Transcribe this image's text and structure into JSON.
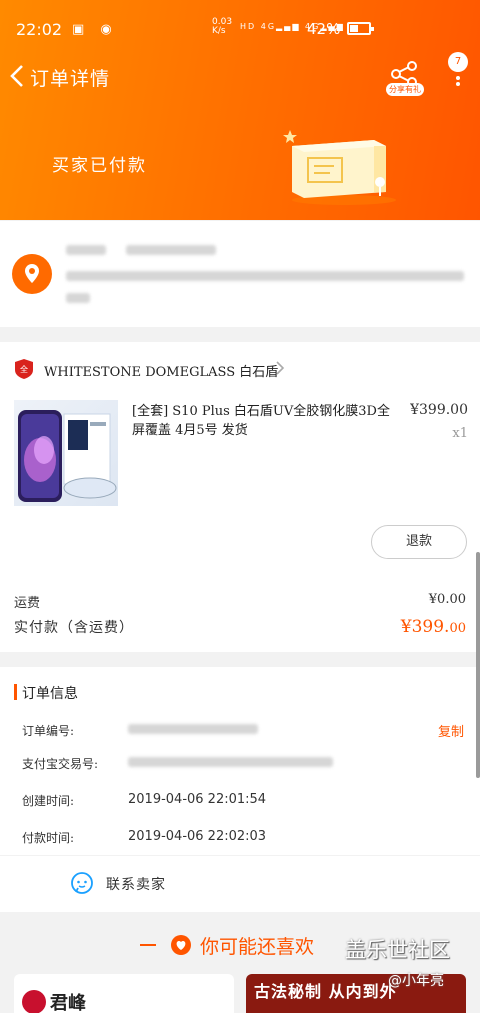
{
  "status_bar": {
    "time": "22:02",
    "net_speed": "0.03\nK/s",
    "net_type": "HD",
    "signal1": "4G",
    "signal2": "4G",
    "battery_pct": "42%"
  },
  "nav": {
    "title": "订单详情",
    "share_label": "分享有礼",
    "more_badge": "7"
  },
  "hero": {
    "status_text": "买家已付款",
    "bg_color": "#ff6a00"
  },
  "shop": {
    "name": "WHITESTONE DOMEGLASS 白石盾"
  },
  "product": {
    "title": "[全套] S10 Plus 白石盾UV全胶钢化膜3D全屏覆盖 4月5号 发货",
    "price": "¥399.00",
    "qty": "x1",
    "refund_label": "退款"
  },
  "costs": {
    "shipping_label": "运费",
    "shipping_value": "¥0.00",
    "total_label": "实付款（含运费）",
    "total_main": "¥399.",
    "total_cents": "00"
  },
  "order_info": {
    "heading": "订单信息",
    "rows": [
      {
        "label": "订单编号:",
        "value": ""
      },
      {
        "label": "支付宝交易号:",
        "value": ""
      },
      {
        "label": "创建时间:",
        "value": "2019-04-06 22:01:54"
      },
      {
        "label": "付款时间:",
        "value": "2019-04-06 22:02:03"
      }
    ],
    "copy_label": "复制"
  },
  "contact": {
    "label": "联系卖家"
  },
  "recommend": {
    "title": "你可能还喜欢",
    "brand": "君峰",
    "banner": "古法秘制 从内到外"
  },
  "watermark": {
    "main": "盖乐世社区",
    "sub": "@小年亮"
  },
  "colors": {
    "accent": "#ff5500",
    "hero_gradient_start": "#ff8a00",
    "price_color": "#ff5500"
  }
}
